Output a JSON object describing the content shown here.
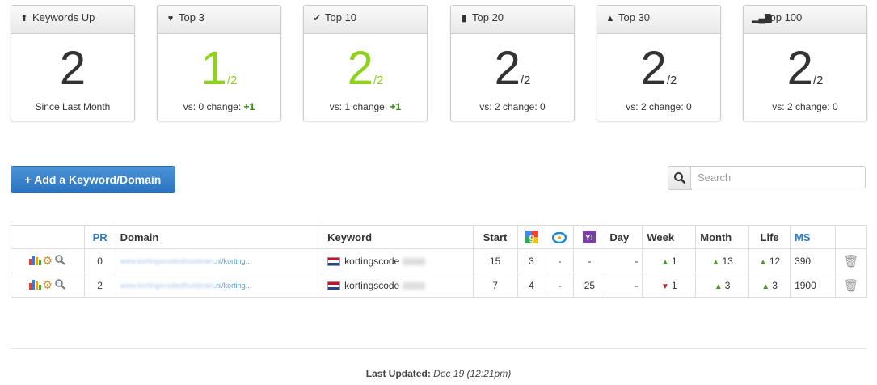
{
  "cards": [
    {
      "icon": "arrow-up-icon",
      "glyph": "⬆",
      "title": "Keywords Up",
      "value": "2",
      "denom": "",
      "foot": "Since Last Month",
      "vs": "",
      "change": "",
      "green": false
    },
    {
      "icon": "heart-icon",
      "glyph": "♥",
      "title": "Top 3",
      "value": "1",
      "denom": "/2",
      "foot": "",
      "vs": "vs: 0 change: ",
      "change": "+1",
      "green": true
    },
    {
      "icon": "check-icon",
      "glyph": "✔",
      "title": "Top 10",
      "value": "2",
      "denom": "/2",
      "foot": "",
      "vs": "vs: 1 change: ",
      "change": "+1",
      "green": true
    },
    {
      "icon": "bookmark-icon",
      "glyph": "▮",
      "title": "Top 20",
      "value": "2",
      "denom": "/2",
      "foot": "",
      "vs": "vs: 2 change: 0",
      "change": "",
      "green": false
    },
    {
      "icon": "road-icon",
      "glyph": "▲",
      "title": "Top 30",
      "value": "2",
      "denom": "/2",
      "foot": "",
      "vs": "vs: 2 change: 0",
      "change": "",
      "green": false
    },
    {
      "icon": "signal-icon",
      "glyph": "▂▄▆",
      "title": "Top 100",
      "value": "2",
      "denom": "/2",
      "foot": "",
      "vs": "vs: 2 change: 0",
      "change": "",
      "green": false
    }
  ],
  "add_button": {
    "plus": "+",
    "label": "Add a Keyword/Domain"
  },
  "search": {
    "placeholder": "Search"
  },
  "table": {
    "headers": {
      "pr": "PR",
      "domain": "Domain",
      "keyword": "Keyword",
      "start": "Start",
      "day": "Day",
      "week": "Week",
      "month": "Month",
      "life": "Life",
      "ms": "MS"
    },
    "rows": [
      {
        "pr": "0",
        "domain_blur": "www.kortingscodesthuisbrain",
        "domain_tail": ".nl/korting..",
        "keyword": "kortingscode",
        "start": "15",
        "google": "3",
        "bing": "-",
        "yahoo": "-",
        "day": "-",
        "week": "1",
        "week_dir": "up",
        "month": "13",
        "month_dir": "up",
        "life": "12",
        "life_dir": "up",
        "ms": "390"
      },
      {
        "pr": "2",
        "domain_blur": "www.kortingscodesthuisbrain",
        "domain_tail": ".nl/korting..",
        "keyword": "kortingscode",
        "start": "7",
        "google": "4",
        "bing": "-",
        "yahoo": "25",
        "day": "-",
        "week": "1",
        "week_dir": "down",
        "month": "3",
        "month_dir": "up",
        "life": "3",
        "life_dir": "up",
        "ms": "1900"
      }
    ]
  },
  "footer": {
    "label": "Last Updated",
    "value": "Dec 19 (12:21pm)"
  },
  "colors": {
    "green": "#8fd21b",
    "primary": "#337ab7",
    "link": "#2b7bc2"
  }
}
